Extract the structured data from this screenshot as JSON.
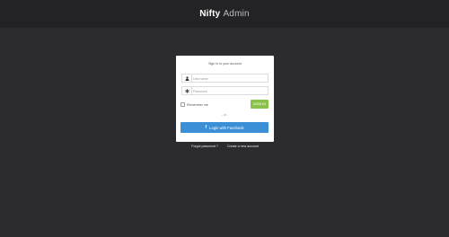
{
  "header": {
    "brand_bold": "Nifty",
    "brand_light": "Admin"
  },
  "login": {
    "title": "Sign In to your account",
    "username_placeholder": "Username",
    "password_placeholder": "Password",
    "remember_label": "Remember me",
    "signin_label": "SIGN IN",
    "or_label": "- or -",
    "facebook_icon": "facebook-icon",
    "facebook_label": "Login with Facebook"
  },
  "footer_links": {
    "forgot": "Forgot password ?",
    "create": "Create a new account"
  },
  "colors": {
    "background": "#2b2b30",
    "topbar": "#232326",
    "signin_button": "#8bc34a",
    "facebook_button": "#3b8fd4"
  }
}
